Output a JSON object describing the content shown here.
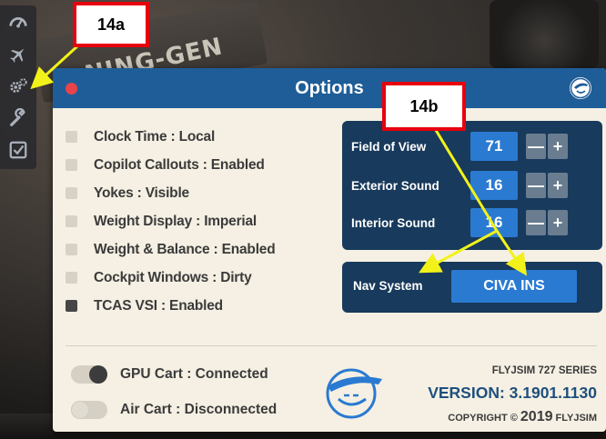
{
  "background": {
    "placard_text": "NING-GEN"
  },
  "sidebar": {
    "items": [
      {
        "icon": "gauge-icon"
      },
      {
        "icon": "airplane-icon"
      },
      {
        "icon": "gears-icon"
      },
      {
        "icon": "wrench-icon"
      },
      {
        "icon": "checklist-icon"
      }
    ]
  },
  "window": {
    "title": "Options",
    "options": [
      {
        "label": "Clock Time : Local",
        "checked": false
      },
      {
        "label": "Copilot Callouts : Enabled",
        "checked": false
      },
      {
        "label": "Yokes : Visible",
        "checked": false
      },
      {
        "label": "Weight Display : Imperial",
        "checked": false
      },
      {
        "label": "Weight & Balance : Enabled",
        "checked": false
      },
      {
        "label": "Cockpit Windows : Dirty",
        "checked": false
      },
      {
        "label": "TCAS VSI : Enabled",
        "checked": true
      }
    ],
    "settings": [
      {
        "label": "Field of View",
        "value": "71"
      },
      {
        "label": "Exterior Sound",
        "value": "16"
      },
      {
        "label": "Interior Sound",
        "value": "16"
      }
    ],
    "stepper": {
      "minus": "—",
      "plus": "+"
    },
    "nav": {
      "label": "Nav System",
      "value": "CIVA INS"
    },
    "toggles": [
      {
        "label": "GPU Cart : Connected",
        "on": true
      },
      {
        "label": "Air Cart : Disconnected",
        "on": false
      }
    ],
    "brand": {
      "series": "FLYJSIM 727 SERIES",
      "version": "VERSION: 3.1901.1130",
      "copyright_prefix": "COPYRIGHT © ",
      "year": "2019",
      "copyright_suffix": " FLYJSIM"
    }
  },
  "callouts": {
    "a": "14a",
    "b": "14b"
  },
  "colors": {
    "titlebar": "#1f5d98",
    "panel": "#183a5c",
    "value": "#2a7ad1",
    "callout_border": "#e8000d",
    "arrow": "#f2f21a"
  }
}
